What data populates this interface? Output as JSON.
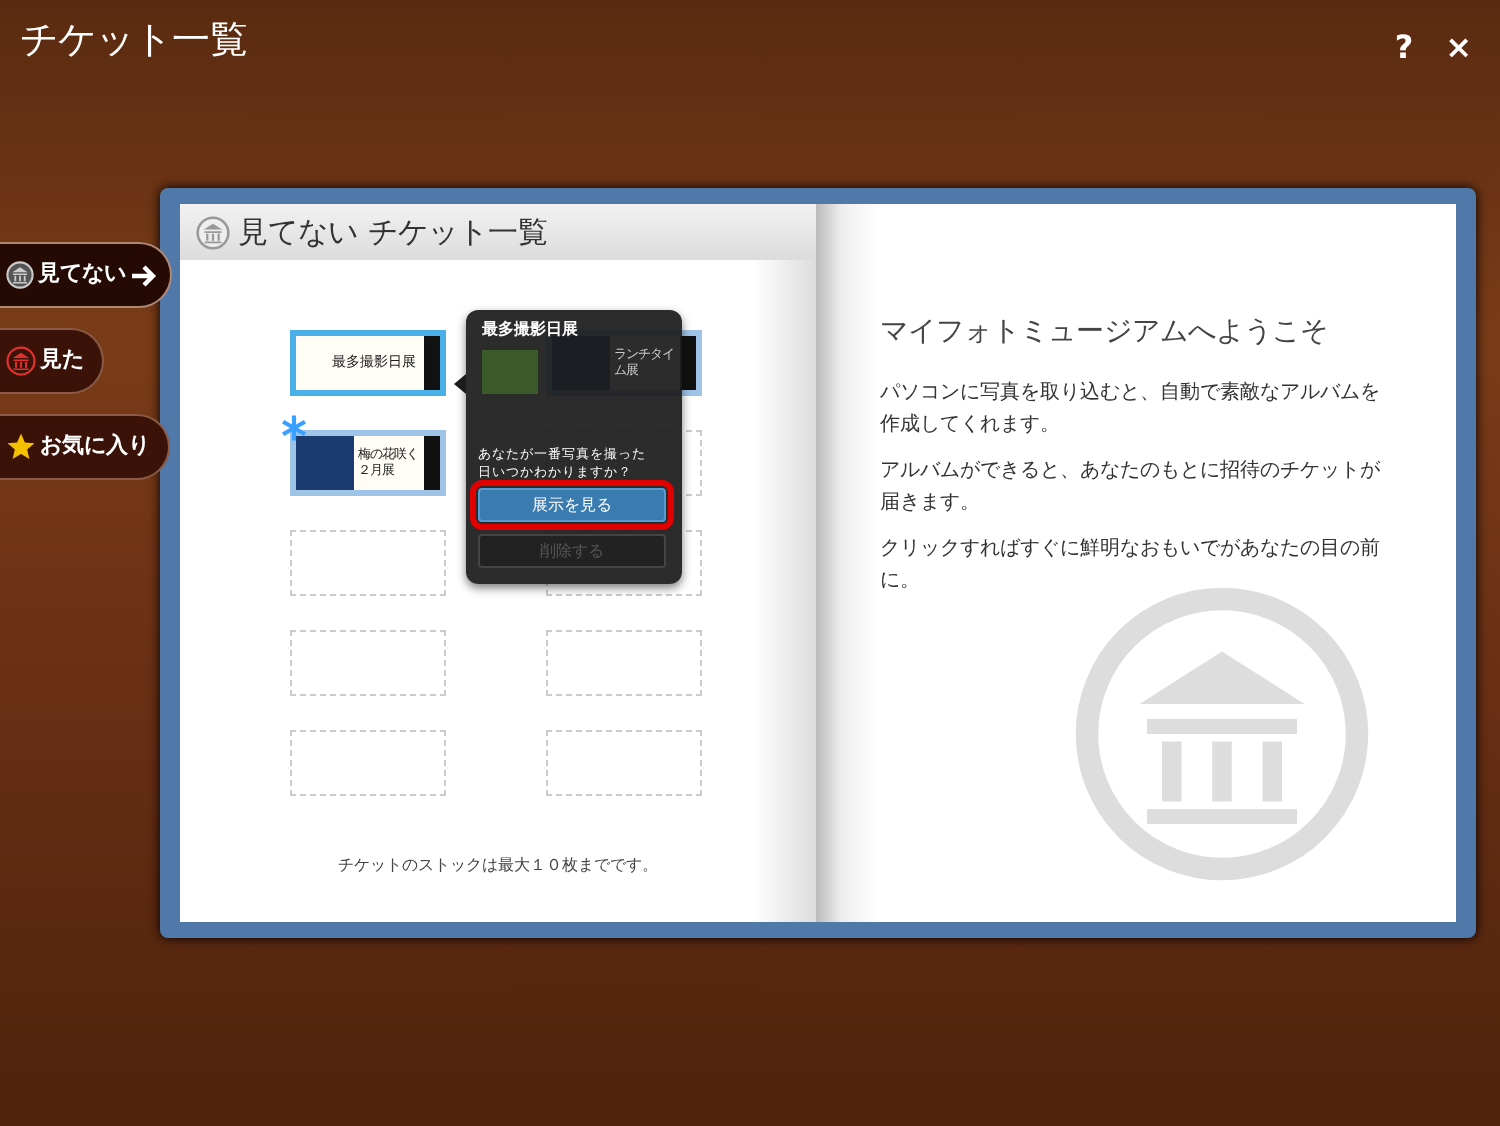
{
  "window": {
    "title": "チケット一覧",
    "help_label": "?",
    "close_label": "×"
  },
  "sidebar": {
    "items": [
      {
        "label": "見てない",
        "kind": "museum",
        "selected": true
      },
      {
        "label": "見た",
        "kind": "museum",
        "selected": false
      },
      {
        "label": "お気に入り",
        "kind": "star",
        "selected": false
      }
    ]
  },
  "left_page": {
    "title": "見てない チケット一覧",
    "tickets": [
      {
        "kind": "ticket",
        "title": "最多撮影日展",
        "photo": false,
        "new": false,
        "selected": true
      },
      {
        "kind": "ticket",
        "title": "ランチタイム展",
        "photo": true,
        "new": false,
        "selected": false
      },
      {
        "kind": "ticket",
        "title": "梅の花咲く２月展",
        "photo": true,
        "new": true,
        "selected": false
      },
      {
        "kind": "empty"
      },
      {
        "kind": "empty"
      },
      {
        "kind": "empty"
      },
      {
        "kind": "empty"
      },
      {
        "kind": "empty"
      },
      {
        "kind": "empty"
      },
      {
        "kind": "empty"
      }
    ],
    "footer": "チケットのストックは最大１０枚までです。"
  },
  "popover": {
    "title": "最多撮影日展",
    "question": "あなたが一番写真を撮った日いつかわかりますか？",
    "primary_button": {
      "label": "展示を見る",
      "highlighted": true
    },
    "secondary_button": {
      "label": "削除する",
      "disabled": true
    }
  },
  "right_page": {
    "heading": "マイフォトミュージアムへようこそ",
    "paragraphs": [
      "パソコンに写真を取り込むと、自動で素敵なアルバムを作成してくれます。",
      "アルバムができると、あなたのもとに招待のチケットが届きます。",
      "クリックすればすぐに鮮明なおもいでがあなたの目の前に。"
    ]
  }
}
